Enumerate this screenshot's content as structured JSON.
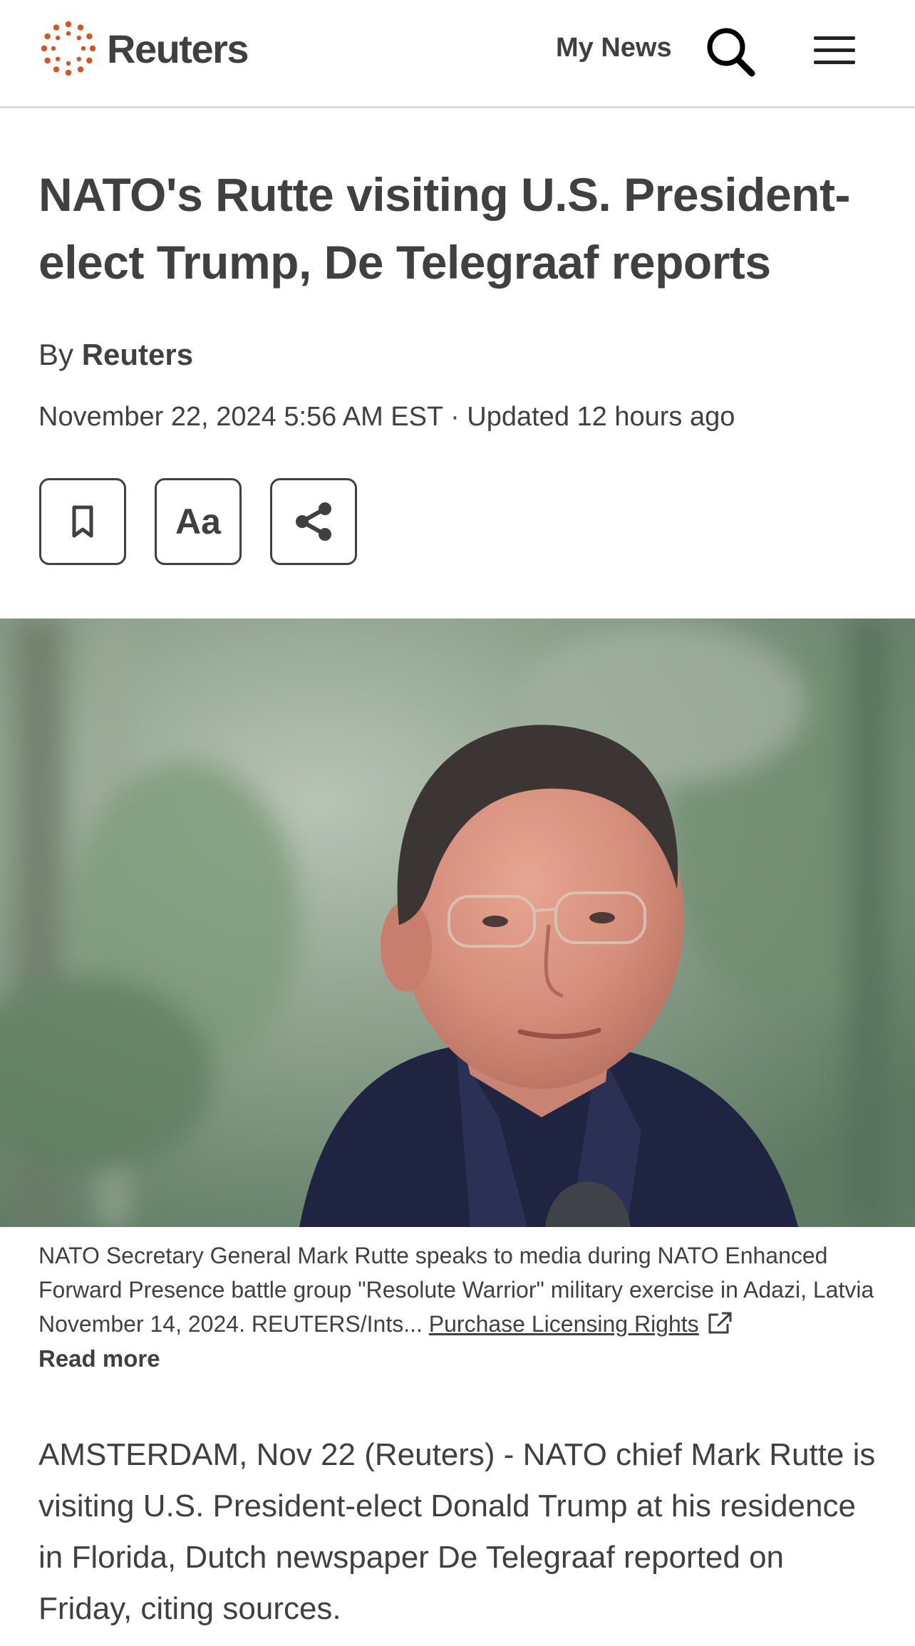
{
  "header": {
    "brand": "Reuters",
    "brand_color": "#d5541f",
    "my_news_label": "My News",
    "search_icon": "search-icon",
    "menu_icon": "hamburger-menu-icon"
  },
  "article": {
    "headline": "NATO's Rutte visiting U.S. President-elect Trump, De Telegraaf reports",
    "byline_prefix": "By",
    "byline_author": "Reuters",
    "dateline": "November 22, 2024 5:56 AM EST · Updated 12 hours ago",
    "tools": {
      "bookmark_icon": "bookmark-icon",
      "text_size_label": "Aa",
      "share_icon": "share-icon"
    },
    "photo": {
      "caption": "NATO Secretary General Mark Rutte speaks to media during NATO Enhanced Forward Presence battle group \"Resolute Warrior\" military exercise in Adazi, Latvia November 14, 2024. REUTERS/Ints...",
      "licensing_link": "Purchase Licensing Rights",
      "read_more": "Read more"
    },
    "body": [
      "AMSTERDAM, Nov 22 (Reuters) - NATO chief Mark Rutte is visiting U.S. President-elect Donald Trump at his residence in Florida, Dutch newspaper De Telegraaf reported on Friday, citing sources."
    ]
  }
}
